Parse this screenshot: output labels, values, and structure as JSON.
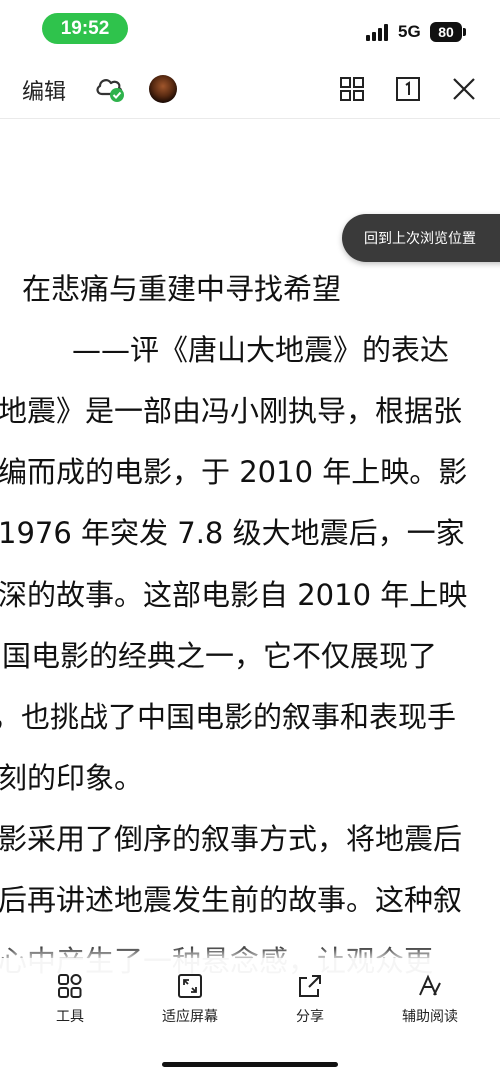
{
  "status_bar": {
    "time": "19:52",
    "network": "5G",
    "battery": "80"
  },
  "toolbar": {
    "edit_label": "编辑",
    "icons": [
      "cloud-synced-icon",
      "avatar",
      "grid-icon",
      "page-one-icon",
      "close-icon"
    ]
  },
  "return_button": {
    "label": "回到上次浏览位置"
  },
  "document": {
    "title": "在悲痛与重建中寻找希望",
    "subtitle": "——评《唐山大地震》的表达",
    "lines": [
      "地震》是一部由冯小刚执导，根据张",
      "编而成的电影，于 2010 年上映。影",
      " 1976 年突发 7.8 级大地震后，一家",
      "深的故事。这部电影自 2010 年上映",
      "国电影的经典之一，它不仅展现了",
      "，也挑战了中国电影的叙事和表现手",
      "刻的印象。",
      "影采用了倒序的叙事方式，将地震后",
      "后再讲述地震发生前的故事。这种叙",
      "心中产生了一种悬念感，让观众更"
    ]
  },
  "bottom_bar": {
    "items": [
      {
        "label": "工具",
        "icon": "tools-icon"
      },
      {
        "label": "适应屏幕",
        "icon": "fit-screen-icon"
      },
      {
        "label": "分享",
        "icon": "share-icon"
      },
      {
        "label": "辅助阅读",
        "icon": "assist-read-icon"
      }
    ]
  }
}
